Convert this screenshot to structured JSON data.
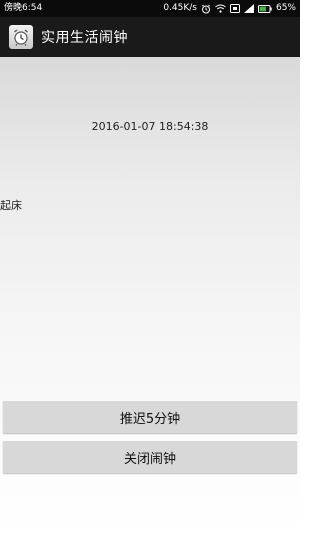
{
  "status_bar": {
    "time": "傍晚6:54",
    "network_speed": "0.45K/s",
    "battery": "65%",
    "icons": [
      "alarm-icon",
      "wifi-icon",
      "screen-icon",
      "signal-icon",
      "battery-icon"
    ]
  },
  "app_bar": {
    "title": "实用生活闹钟",
    "icon": "alarm-clock-icon"
  },
  "content": {
    "datetime": "2016-01-07 18:54:38",
    "alarm_label": "起床"
  },
  "buttons": {
    "snooze": "推迟5分钟",
    "close": "关闭闹钟"
  },
  "colors": {
    "status_bar_bg": "#0b0b0b",
    "app_bar_bg": "#1a1a1a",
    "button_bg": "#d8d8d8",
    "battery_green": "#4caf50"
  }
}
